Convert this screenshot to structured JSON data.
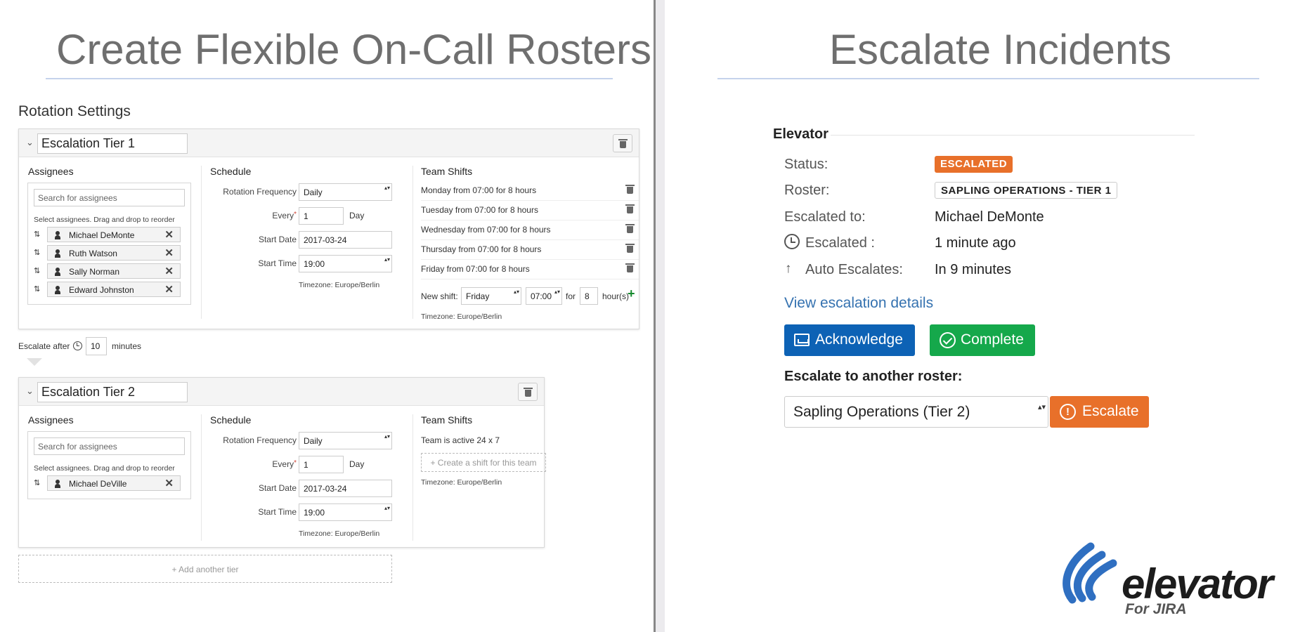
{
  "left": {
    "title": "Create Flexible On-Call Rosters",
    "section_title": "Rotation Settings",
    "labels": {
      "assignees": "Assignees",
      "schedule": "Schedule",
      "team_shifts": "Team Shifts",
      "search_placeholder": "Search for assignees",
      "hint": "Select assignees. Drag and drop to reorder",
      "rotation_frequency": "Rotation Frequency",
      "every": "Every",
      "required_mark": "*",
      "day": "Day",
      "start_date": "Start Date",
      "start_time": "Start Time",
      "timezone": "Timezone: Europe/Berlin",
      "new_shift": "New shift:",
      "for": "for",
      "hours": "hour(s)"
    },
    "tier1": {
      "name": "Escalation Tier 1",
      "assignees": [
        "Michael DeMonte",
        "Ruth Watson",
        "Sally Norman",
        "Edward Johnston"
      ],
      "rotation_frequency": "Daily",
      "every": "1",
      "start_date": "2017-03-24",
      "start_time": "19:00",
      "shifts": [
        "Monday from 07:00 for 8 hours",
        "Tuesday from 07:00 for 8 hours",
        "Wednesday from 07:00 for 8 hours",
        "Thursday from 07:00 for 8 hours",
        "Friday from 07:00 for 8 hours"
      ],
      "new_shift_day": "Friday",
      "new_shift_time": "07:00",
      "new_shift_hours": "8"
    },
    "escalate_after": {
      "prefix": "Escalate after",
      "value": "10",
      "suffix": "minutes"
    },
    "tier2": {
      "name": "Escalation Tier 2",
      "assignees": [
        "Michael DeVille"
      ],
      "rotation_frequency": "Daily",
      "every": "1",
      "start_date": "2017-03-24",
      "start_time": "19:00",
      "team_active": "Team is active 24 x 7",
      "create_shift": "Create a shift for this team"
    },
    "add_tier": "Add another tier"
  },
  "right": {
    "title": "Escalate Incidents",
    "fieldset_title": "Elevator",
    "status_label": "Status:",
    "status_value": "ESCALATED",
    "roster_label": "Roster:",
    "roster_value": "SAPLING OPERATIONS - TIER 1",
    "escalated_to_label": "Escalated to:",
    "escalated_to_value": "Michael DeMonte",
    "escalated_label": "Escalated :",
    "escalated_value": "1 minute ago",
    "auto_label": "Auto Escalates:",
    "auto_value": "In 9 minutes",
    "details_link": "View escalation details",
    "acknowledge": "Acknowledge",
    "complete": "Complete",
    "escalate_heading": "Escalate to another roster:",
    "roster_select": "Sapling Operations (Tier 2)",
    "escalate_button": "Escalate",
    "logo_text": "elevator",
    "logo_sub": "For JIRA"
  },
  "colors": {
    "acknowledge": "#0d62b5",
    "complete": "#15a84b",
    "escalate": "#e8702a",
    "link": "#3572b0",
    "logo_blue": "#2f6fc1"
  }
}
